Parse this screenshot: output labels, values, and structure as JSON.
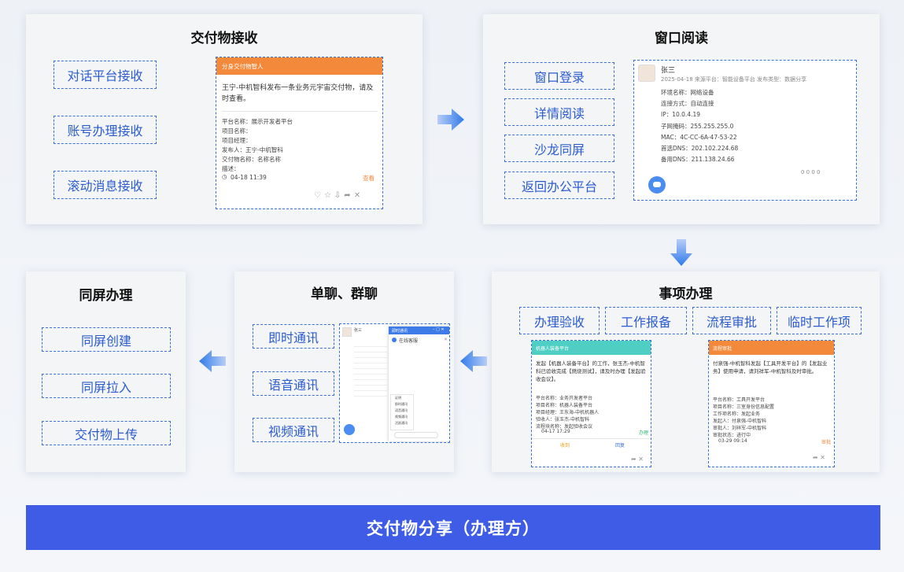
{
  "panel1": {
    "title": "交付物接收",
    "tags": [
      "对话平台接收",
      "账号办理接收",
      "滚动消息接收"
    ],
    "card": {
      "header": "分身交付物智人",
      "message": "王宁-中机智科发布一条业务元宇宙交付物，请及时查看。",
      "fields": [
        "平台名称：展示开发者平台",
        "项目名称：",
        "项目经理：",
        "发布人：王宁-中机智科",
        "交付物名称：名称名称",
        "描述："
      ],
      "time": "04-18 11:39",
      "view": "查看"
    }
  },
  "panel2": {
    "title": "窗口阅读",
    "tags": [
      "窗口登录",
      "详情阅读",
      "沙龙同屏",
      "返回办公平台"
    ],
    "card": {
      "name": "张三",
      "meta": "2025-04-18     来源平台：智能设备平台     发布类型：数据分享",
      "fields": [
        "环境名称：网络设备",
        "连接方式：自动连接",
        "IP：10.0.4.19",
        "子网掩码：255.255.255.0",
        "MAC：4C-CC-6A-47-53-22",
        "首选DNS：202.102.224.68",
        "备用DNS：211.138.24.66"
      ],
      "stats": "0  0  0  0"
    }
  },
  "panel3": {
    "title": "事项办理",
    "tags": [
      "办理验收",
      "工作报备",
      "流程审批",
      "临时工作项"
    ],
    "card_a": {
      "header": "机器人装备平台",
      "message": "发起【机器人装备平台】的工作，张玉杰-中机智科已验收完成【燃烧测试】，请及时办理【发起验收会议】。",
      "fields": [
        "平台名称：业务开发者平台",
        "项目名称：机器人装备平台",
        "项目经理：王东海-中机机器人",
        "验收人：张玉杰-中机智科",
        "流程块名称：发起验收会议"
      ],
      "time": "04-17 17:29",
      "status": "办理",
      "btn1": "收到",
      "btn2": "回复"
    },
    "card_b": {
      "header": "流程审批",
      "message": "付泉强-中机智科发起【工具开发平台】的【发起业务】使用申请，请刘祥军-中机智科及时审批。",
      "fields": [
        "平台名称：工具开发平台",
        "项目名称：三室身份信息配置",
        "工作项名称：发起业务",
        "发起人：付泉强-中机智科",
        "审批人：刘祥军-中机智科",
        "审批状态：进行中"
      ],
      "time": "03-29 09:14",
      "status": "审批"
    }
  },
  "panel4": {
    "title": "单聊、群聊",
    "tags": [
      "即时通讯",
      "语音通讯",
      "视频通讯"
    ],
    "chat": {
      "window_title": "即时通讯",
      "service": "在线客服",
      "name": "张三",
      "menu": [
        "证明",
        "即时通讯",
        "语音通讯",
        "视频通讯",
        "活跃通讯"
      ]
    }
  },
  "panel5": {
    "title": "同屏办理",
    "tags": [
      "同屏创建",
      "同屏拉入",
      "交付物上传"
    ]
  },
  "footer": {
    "label": "交付物分享（办理方）"
  }
}
